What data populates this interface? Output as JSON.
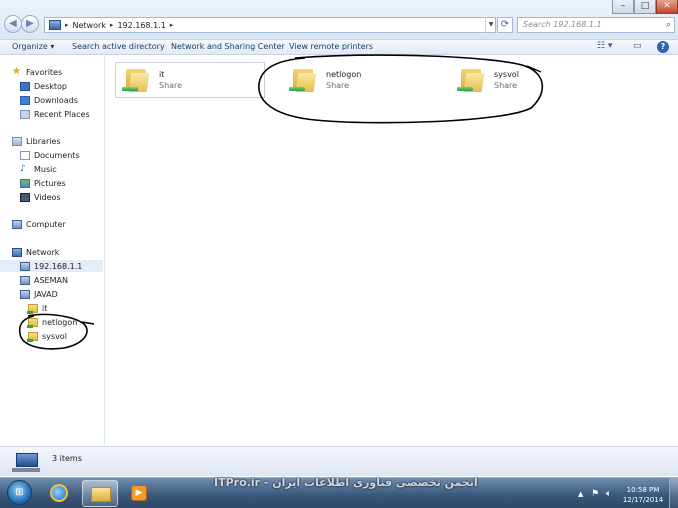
{
  "address": {
    "crumbs": [
      "Network",
      "192.168.1.1"
    ],
    "search_placeholder": "Search 192.168.1.1"
  },
  "toolbar": {
    "organize": "Organize",
    "search_ad": "Search active directory",
    "network_sharing": "Network and Sharing Center",
    "view_printers": "View remote printers"
  },
  "nav": {
    "favorites": "Favorites",
    "desktop": "Desktop",
    "downloads": "Downloads",
    "recent": "Recent Places",
    "libraries": "Libraries",
    "documents": "Documents",
    "music": "Music",
    "pictures": "Pictures",
    "videos": "Videos",
    "computer": "Computer",
    "network": "Network",
    "host_ip": "192.168.1.1",
    "aseman": "ASEMAN",
    "javad": "JAVAD",
    "share_it": "it",
    "share_netlogon": "netlogon",
    "share_sysvol": "sysvol"
  },
  "items": [
    {
      "name": "it",
      "type": "Share"
    },
    {
      "name": "netlogon",
      "type": "Share"
    },
    {
      "name": "sysvol",
      "type": "Share"
    }
  ],
  "details": {
    "count": "3 items"
  },
  "taskbar": {
    "time": "10:58 PM",
    "date": "12/17/2014",
    "watermark": "انجمن تخصصی فناوری اطلاعات ایران - ITPro.ir"
  },
  "colors": {
    "accent": "#2d63b8",
    "selection": "#e3ecf7",
    "annotation": "#000000"
  }
}
